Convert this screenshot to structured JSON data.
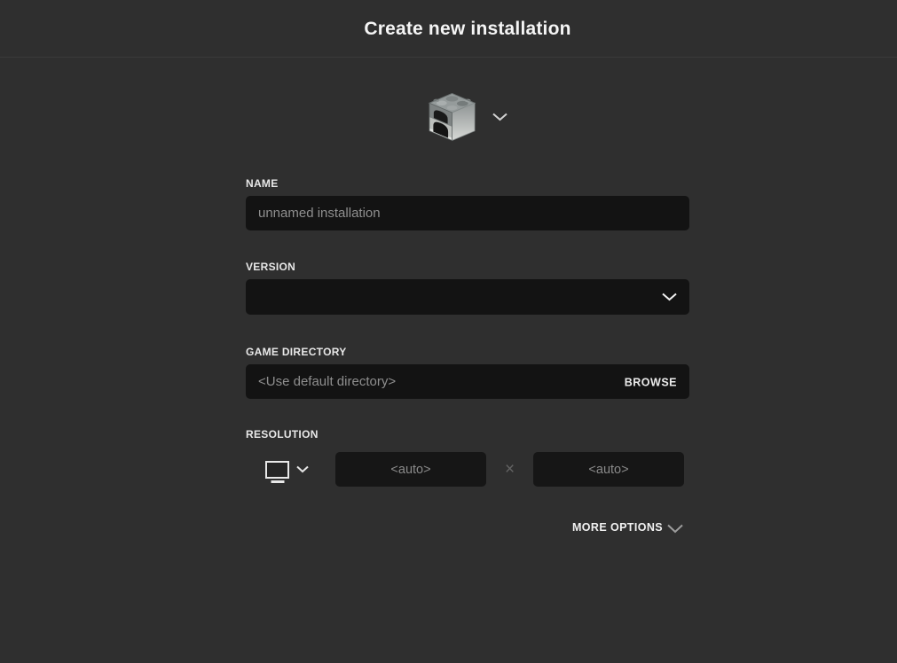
{
  "header": {
    "title": "Create new installation"
  },
  "icon_picker": {
    "icon_name": "furnace-block"
  },
  "form": {
    "name": {
      "label": "NAME",
      "placeholder": "unnamed installation",
      "value": ""
    },
    "version": {
      "label": "VERSION",
      "selected_value": ""
    },
    "game_directory": {
      "label": "GAME DIRECTORY",
      "placeholder": "<Use default directory>",
      "value": "",
      "browse_label": "BROWSE"
    },
    "resolution": {
      "label": "RESOLUTION",
      "width_placeholder": "<auto>",
      "height_placeholder": "<auto>",
      "width_value": "",
      "height_value": "",
      "separator": "×"
    },
    "more_options_label": "MORE OPTIONS"
  },
  "colors": {
    "background": "#2f2f2f",
    "header_divider": "#3a3a3a",
    "input_background": "#131313",
    "resolution_input_background": "#161616",
    "placeholder_text": "#8f8f8f",
    "label_text": "#e8e8e8",
    "title_text": "#f5f5f5"
  }
}
